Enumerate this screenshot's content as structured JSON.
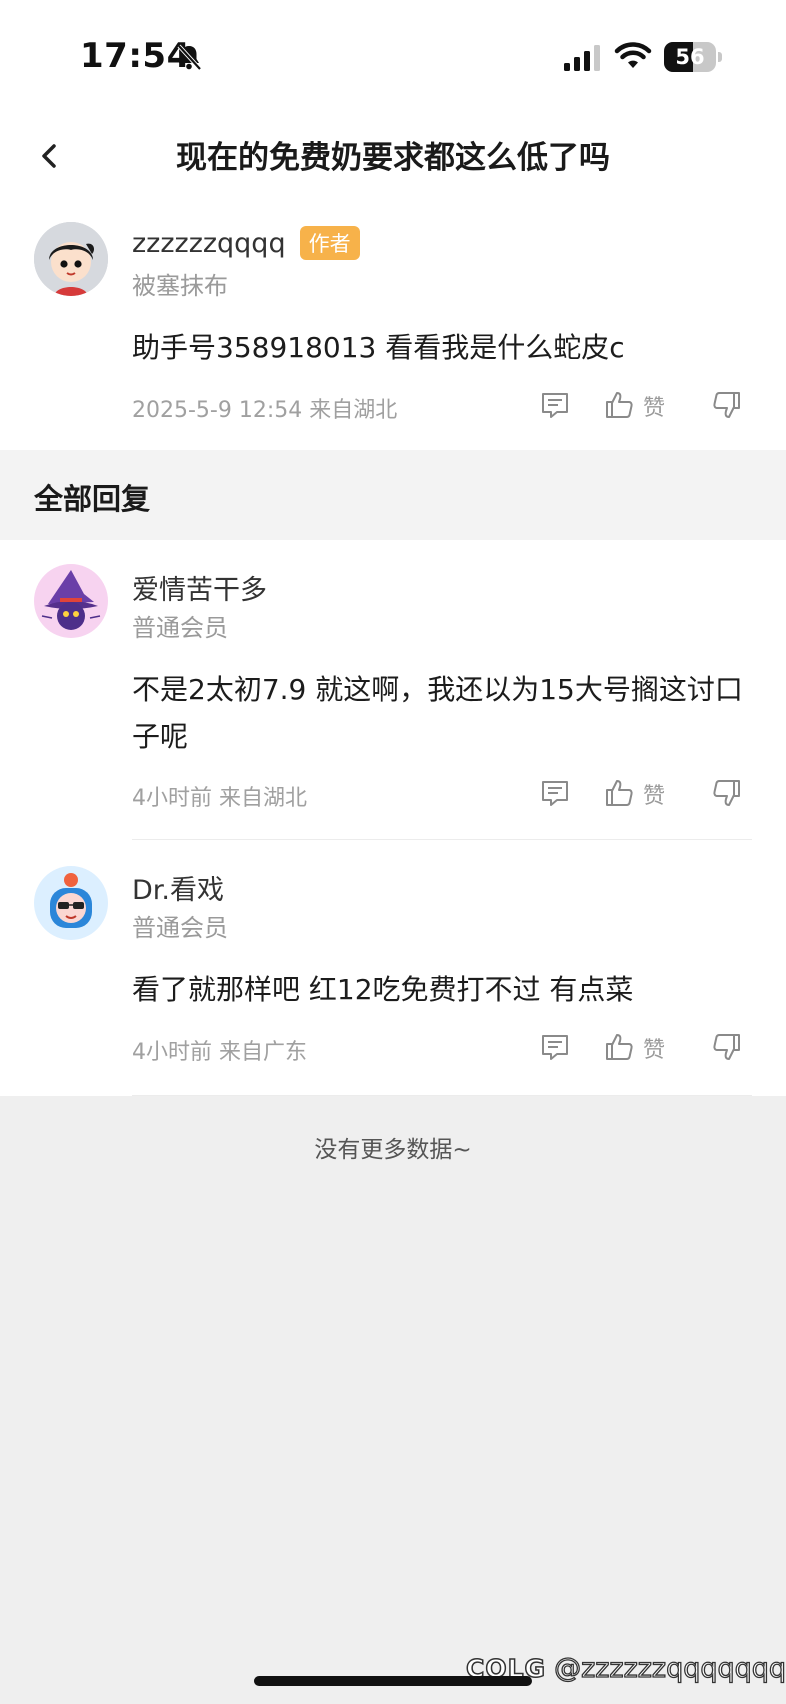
{
  "status_bar": {
    "time": "17:54",
    "battery": "56",
    "battery_level": 0.56
  },
  "nav": {
    "title": "现在的免费奶要求都这么低了吗"
  },
  "post": {
    "username": "zzzzzzqqqq",
    "badge": "作者",
    "level": "被塞抹布",
    "text": "助手号358918013  看看我是什么蛇皮c",
    "meta": "2025-5-9 12:54  来自湖北",
    "like_label": "赞"
  },
  "replies": {
    "header": "全部回复",
    "items": [
      {
        "username": "爱情苦干多",
        "level": "普通会员",
        "text": "不是2太初7.9 就这啊，我还以为15大号搁这讨口子呢",
        "meta": "4小时前 来自湖北",
        "like_label": "赞"
      },
      {
        "username": "Dr.看戏",
        "level": "普通会员",
        "text": "看了就那样吧  红12吃免费打不过  有点菜",
        "meta": "4小时前 来自广东",
        "like_label": "赞"
      }
    ],
    "footer": "没有更多数据~"
  },
  "watermark": {
    "logo": "COLG",
    "handle": "@zzzzzzqqqqqqq"
  },
  "icons": {
    "back": "chevron-left-icon",
    "comment": "comment-icon",
    "like": "thumbs-up-icon",
    "dislike": "thumbs-down-icon",
    "bell": "bell-slash-icon",
    "signal": "cellular-signal-icon",
    "wifi": "wifi-icon"
  },
  "colors": {
    "badge": "#f7b24a",
    "page_bg": "#efefef",
    "section_bg": "#f3f3f3"
  }
}
